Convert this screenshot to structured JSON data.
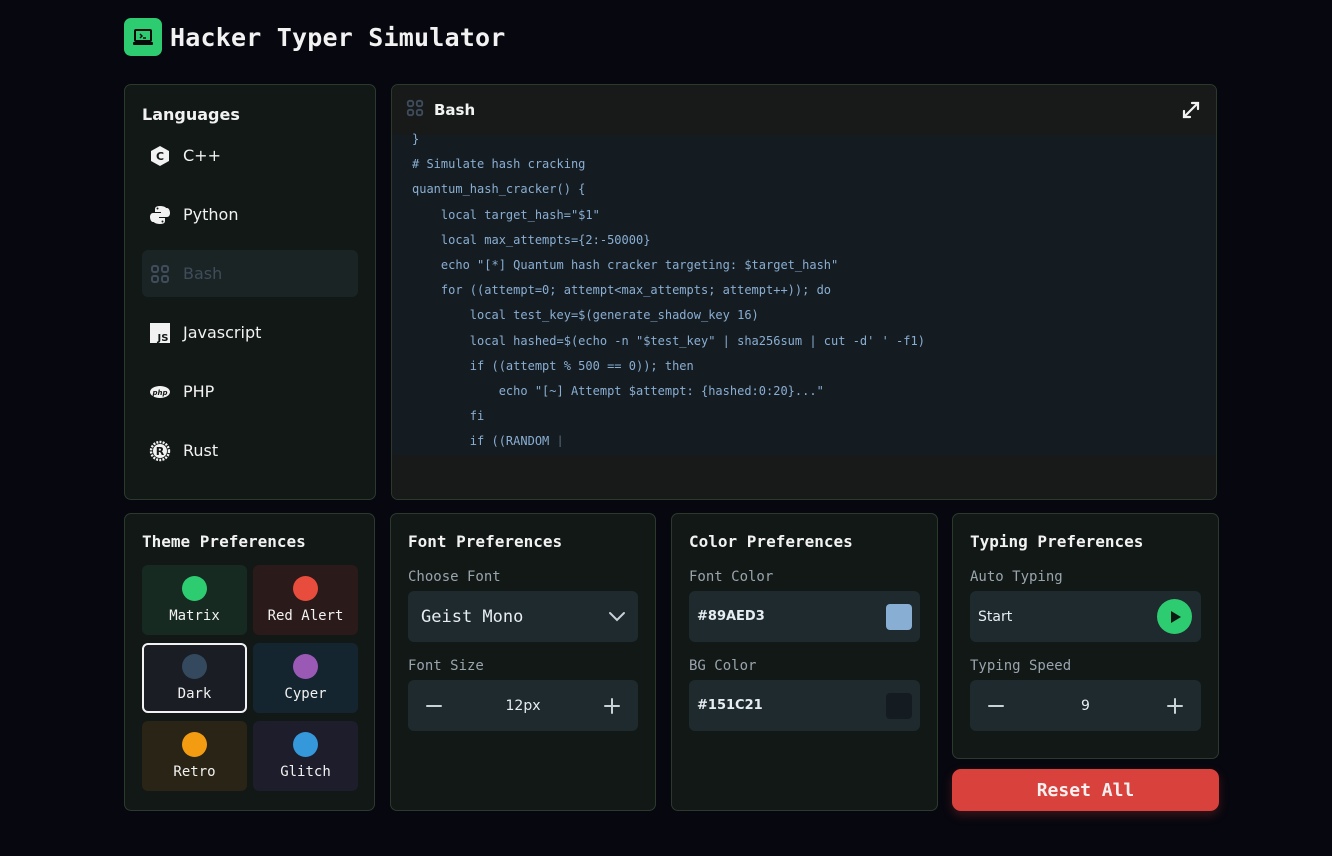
{
  "app": {
    "title": "Hacker Typer Simulator",
    "logo_icon": "laptop-icon"
  },
  "languages": {
    "title": "Languages",
    "items": [
      {
        "label": "C++",
        "icon": "cpp-icon",
        "active": false
      },
      {
        "label": "Python",
        "icon": "python-icon",
        "active": false
      },
      {
        "label": "Bash",
        "icon": "bash-icon",
        "active": true
      },
      {
        "label": "Javascript",
        "icon": "javascript-icon",
        "active": false
      },
      {
        "label": "PHP",
        "icon": "php-icon",
        "active": false
      },
      {
        "label": "Rust",
        "icon": "rust-icon",
        "active": false
      }
    ]
  },
  "editor": {
    "title": "Bash",
    "lines": [
      "}",
      "# Simulate hash cracking",
      "quantum_hash_cracker() {",
      "    local target_hash=\"$1\"",
      "    local max_attempts={2:-50000}",
      "    echo \"[*] Quantum hash cracker targeting: $target_hash\"",
      "    for ((attempt=0; attempt<max_attempts; attempt++)); do",
      "        local test_key=$(generate_shadow_key 16)",
      "        local hashed=$(echo -n \"$test_key\" | sha256sum | cut -d' ' -f1)",
      "        if ((attempt % 500 == 0)); then",
      "            echo \"[~] Attempt $attempt: {hashed:0:20}...\"",
      "        fi",
      "        if ((RANDOM "
    ],
    "caret": "|"
  },
  "theme": {
    "title": "Theme Preferences",
    "options": [
      {
        "label": "Matrix",
        "dot": "#2ecc71",
        "bg": "#162a22",
        "selected": false
      },
      {
        "label": "Red Alert",
        "dot": "#e74c3c",
        "bg": "#2a1a1a",
        "selected": false
      },
      {
        "label": "Dark",
        "dot": "#34495e",
        "bg": "#1a1d24",
        "selected": true
      },
      {
        "label": "Cyper",
        "dot": "#9b59b6",
        "bg": "#152530",
        "selected": false
      },
      {
        "label": "Retro",
        "dot": "#f39c12",
        "bg": "#2a2416",
        "selected": false
      },
      {
        "label": "Glitch",
        "dot": "#3498db",
        "bg": "#1d1d2c",
        "selected": false
      }
    ]
  },
  "font": {
    "title": "Font Preferences",
    "choose_label": "Choose Font",
    "font_value": "Geist Mono",
    "size_label": "Font Size",
    "size_value": "12px"
  },
  "color": {
    "title": "Color Preferences",
    "font_color_label": "Font Color",
    "font_color_value": "#89AED3",
    "bg_color_label": "BG Color",
    "bg_color_value": "#151C21"
  },
  "typing": {
    "title": "Typing Preferences",
    "auto_label": "Auto Typing",
    "auto_value": "Start",
    "speed_label": "Typing Speed",
    "speed_value": "9"
  },
  "reset_label": "Reset All"
}
